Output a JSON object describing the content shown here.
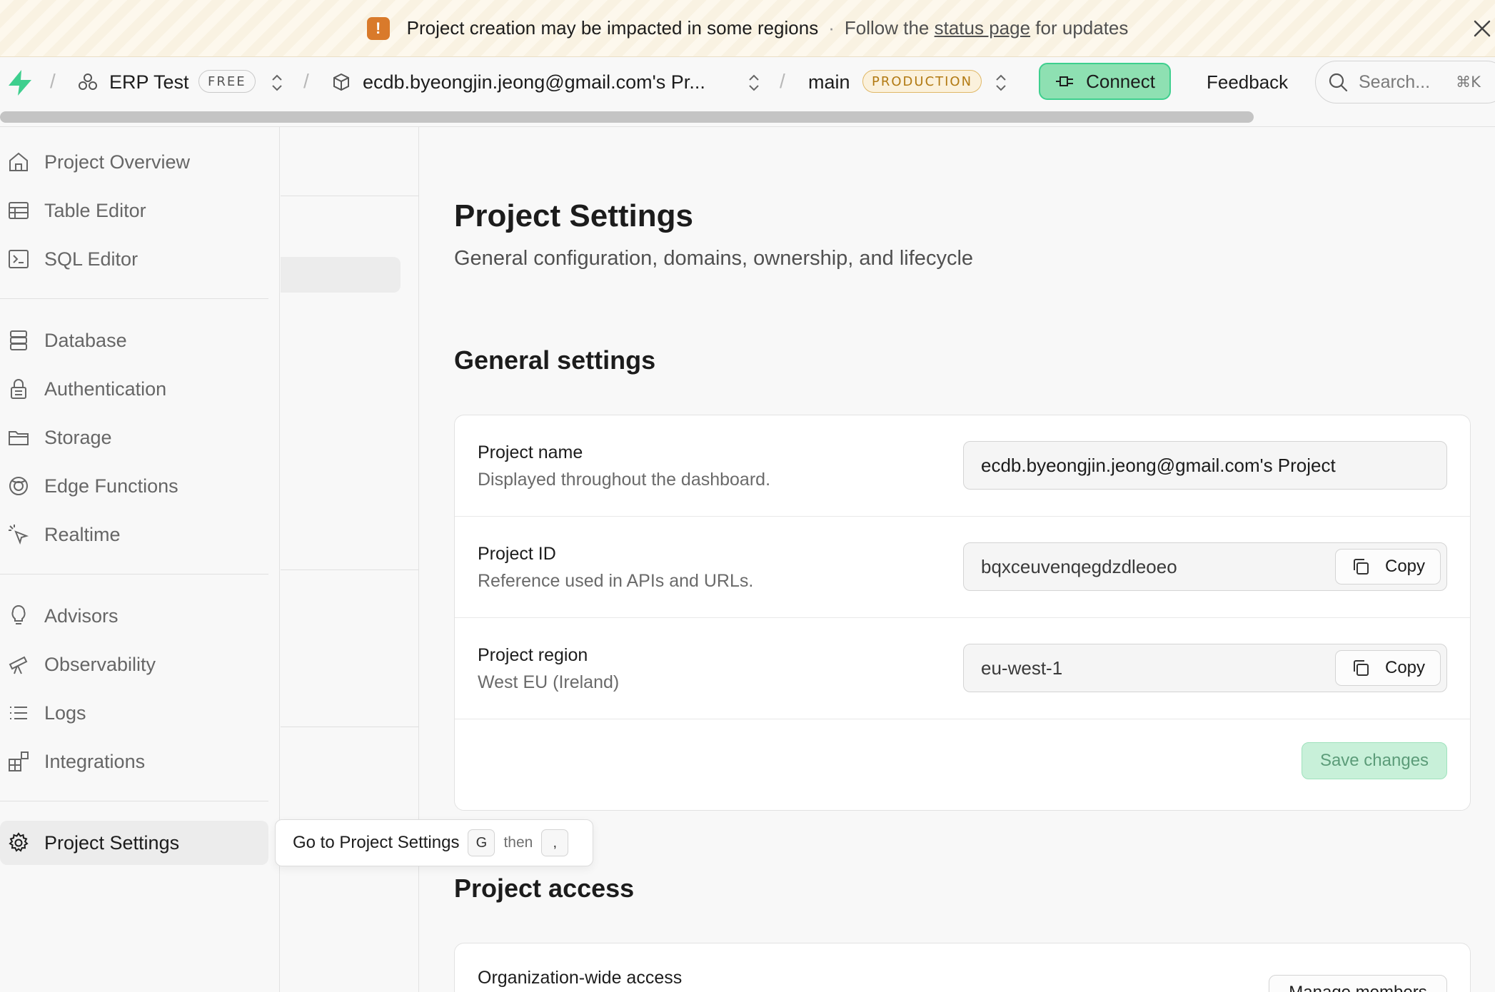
{
  "banner": {
    "message": "Project creation may be impacted in some regions",
    "separator": "·",
    "follow_prefix": "Follow the",
    "link_text": "status page",
    "follow_suffix": "for updates"
  },
  "topnav": {
    "org_name": "ERP Test",
    "org_plan": "FREE",
    "project_name": "ecdb.byeongjin.jeong@gmail.com's Pr...",
    "branch_name": "main",
    "branch_badge": "PRODUCTION",
    "connect_label": "Connect",
    "feedback_label": "Feedback",
    "search_placeholder": "Search...",
    "search_shortcut": "⌘K"
  },
  "sidebar": {
    "items": [
      {
        "label": "Project Overview",
        "icon": "home-icon"
      },
      {
        "label": "Table Editor",
        "icon": "table-icon"
      },
      {
        "label": "SQL Editor",
        "icon": "terminal-icon"
      },
      {
        "label": "Database",
        "icon": "database-icon"
      },
      {
        "label": "Authentication",
        "icon": "lock-icon"
      },
      {
        "label": "Storage",
        "icon": "folder-icon"
      },
      {
        "label": "Edge Functions",
        "icon": "globe-icon"
      },
      {
        "label": "Realtime",
        "icon": "cursor-icon"
      },
      {
        "label": "Advisors",
        "icon": "lightbulb-icon"
      },
      {
        "label": "Observability",
        "icon": "telescope-icon"
      },
      {
        "label": "Logs",
        "icon": "list-icon"
      },
      {
        "label": "Integrations",
        "icon": "blocks-icon"
      },
      {
        "label": "Project Settings",
        "icon": "gear-icon"
      }
    ]
  },
  "tooltip": {
    "text": "Go to Project Settings",
    "key1": "G",
    "then": "then",
    "key2": ","
  },
  "main": {
    "title": "Project Settings",
    "subtitle": "General configuration, domains, ownership, and lifecycle",
    "general": {
      "heading": "General settings",
      "project_name_label": "Project name",
      "project_name_desc": "Displayed throughout the dashboard.",
      "project_name_value": "ecdb.byeongjin.jeong@gmail.com's Project",
      "project_id_label": "Project ID",
      "project_id_desc": "Reference used in APIs and URLs.",
      "project_id_value": "bqxceuvenqegdzdleoeo",
      "project_region_label": "Project region",
      "project_region_desc": "West EU (Ireland)",
      "project_region_value": "eu-west-1",
      "copy_label": "Copy",
      "save_label": "Save changes"
    },
    "access": {
      "heading": "Project access",
      "org_access_label": "Organization-wide access",
      "manage_label": "Manage members"
    }
  },
  "colors": {
    "brand_green": "#3ecf8e",
    "warning_orange": "#d97a2b",
    "production_badge": "#b27a13"
  }
}
